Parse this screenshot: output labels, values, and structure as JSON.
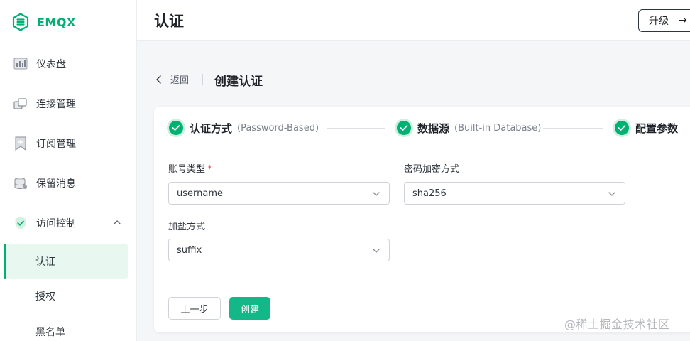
{
  "brand": {
    "name": "EMQX",
    "color": "#00b173"
  },
  "sidebar": {
    "items": [
      {
        "label": "仪表盘",
        "icon": "dashboard-icon"
      },
      {
        "label": "连接管理",
        "icon": "connections-icon"
      },
      {
        "label": "订阅管理",
        "icon": "subscriptions-icon"
      },
      {
        "label": "保留消息",
        "icon": "retained-messages-icon"
      },
      {
        "label": "访问控制",
        "icon": "access-control-icon",
        "expanded": true
      }
    ],
    "subitems": [
      {
        "label": "认证",
        "active": true
      },
      {
        "label": "授权",
        "active": false
      },
      {
        "label": "黑名单",
        "active": false
      }
    ]
  },
  "header": {
    "title": "认证",
    "upgrade_label": "升级",
    "upgrade_icon": "arrow-right-icon"
  },
  "breadcrumb": {
    "back_label": "返回",
    "title": "创建认证"
  },
  "steps": [
    {
      "title": "认证方式",
      "subtitle": "(Password-Based)",
      "status": "done"
    },
    {
      "title": "数据源",
      "subtitle": "(Built-in Database)",
      "status": "done"
    },
    {
      "title": "配置参数",
      "subtitle": "",
      "status": "done"
    }
  ],
  "form": {
    "account_type": {
      "label": "账号类型",
      "required_mark": "*",
      "value": "username"
    },
    "password_hash": {
      "label": "密码加密方式",
      "value": "sha256"
    },
    "salt_position": {
      "label": "加盐方式",
      "value": "suffix"
    }
  },
  "actions": {
    "prev_label": "上一步",
    "create_label": "创建"
  },
  "watermark": "@稀土掘金技术社区",
  "colors": {
    "accent": "#00b173",
    "button": "#14b888",
    "active_bg": "#e8f7f0"
  }
}
